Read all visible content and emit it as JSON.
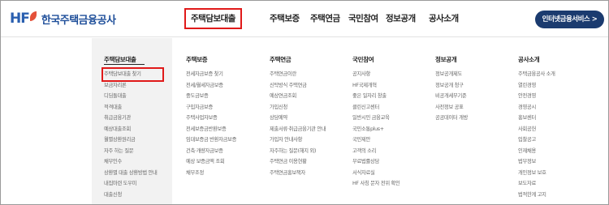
{
  "header": {
    "logo_mark": "HF",
    "logo_text": "한국주택금융공사",
    "nav": [
      {
        "label": "주택담보대출",
        "active": true
      },
      {
        "label": "주택보증",
        "active": false
      },
      {
        "label": "주택연금",
        "active": false
      },
      {
        "label": "국민참여",
        "active": false
      },
      {
        "label": "정보공개",
        "active": false
      },
      {
        "label": "공사소개",
        "active": false
      }
    ],
    "service_button": "인터넷금융서비스 >"
  },
  "mega_menu": {
    "columns": [
      {
        "title": "주택담보대출",
        "items": [
          "주택담보대출 찾기",
          "보금자리론",
          "디딤돌대출",
          "적격대출",
          "취급금융기관",
          "예상대출조회",
          "월별상환원리금",
          "자주 하는 질문",
          "채무인수",
          "상환별 대출 상환방법 안내",
          "내집마련 도우미",
          "대출신청"
        ]
      },
      {
        "title": "주택보증",
        "items": [
          "전세자금보증 찾기",
          "전세/월세자금보증",
          "중도금보증",
          "구입자금보증",
          "주택사업자보증",
          "전세보증금반환보증",
          "임대보증금 반환자금보증",
          "건축·개량자금보증",
          "예상 보증금액 조회",
          "채무조정"
        ]
      },
      {
        "title": "주택연금",
        "items": [
          "주택연금이란",
          "신탁방식 주택연금",
          "예상연금조회",
          "가입신청",
          "상담예약",
          "제출서류·취급금융기관 안내",
          "가입자 안내사항",
          "자주하는 질문(해지 외)",
          "주택연금 이용현황",
          "주택연금홍보책자"
        ]
      },
      {
        "title": "국민참여",
        "items": [
          "공지사항",
          "HF국제개혁",
          "좋은 일자리 창출",
          "클린신고센터",
          "일반시민 금융교육",
          "국민소통plus+",
          "국민제안",
          "고객의 소리",
          "무료법률상담",
          "서식자료실",
          "HF 사칭 문자 전위 확인"
        ]
      },
      {
        "title": "정보공개",
        "items": [
          "정보공개제도",
          "정보공개 청구",
          "비공개세부기준",
          "사전정보 공표",
          "공공데이터 개방"
        ]
      },
      {
        "title": "공사소개",
        "items": [
          "주택금융공사 소개",
          "열린경영",
          "안전경영",
          "경영공시",
          "홍보센터",
          "사회공헌",
          "입찰공고",
          "인재채용",
          "법무정보",
          "개인정보 보호",
          "보도자료",
          "법적한계 고지"
        ]
      }
    ]
  },
  "colors": {
    "brand_navy": "#1b3b6f",
    "brand_blue": "#2a5fb0",
    "leaf_red": "#e4513a",
    "highlight_red": "#e01a1a",
    "first_column_bg": "#f2f2f2"
  }
}
